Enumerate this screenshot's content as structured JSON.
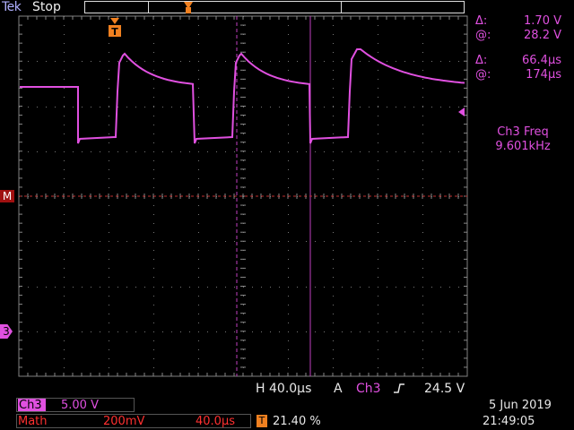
{
  "header": {
    "brand_tek": "Tek",
    "run_status": "Stop"
  },
  "cursor_readouts": {
    "delta_v": {
      "symbol": "Δ:",
      "value": "1.70 V"
    },
    "at_v": {
      "symbol": "@:",
      "value": "28.2 V"
    },
    "delta_t": {
      "symbol": "Δ:",
      "value": "66.4µs"
    },
    "at_t": {
      "symbol": "@:",
      "value": "174µs"
    }
  },
  "measurement": {
    "label": "Ch3 Freq",
    "value": "9.601kHz"
  },
  "markers": {
    "math_marker": "M",
    "channel_marker": "3"
  },
  "timebase": {
    "h_label": "H",
    "h_value": "40.0µs",
    "a_label": "A",
    "trigger_source": "Ch3",
    "trigger_slope_icon": "rising-edge-icon",
    "trigger_level": "24.5 V"
  },
  "channel_settings": {
    "ch3_label": "Ch3",
    "ch3_scale": "5.00 V",
    "math_label": "Math",
    "math_scale": "200mV",
    "math_time": "40.0µs",
    "trigger_pos_icon": "T",
    "trigger_pos_value": "21.40 %"
  },
  "datetime": {
    "date": "5 Jun  2019",
    "time": "21:49:05"
  },
  "colors": {
    "ch3": "#e050e0",
    "math": "#ff3030",
    "trigger": "#f08020",
    "grid": "#808080"
  }
}
